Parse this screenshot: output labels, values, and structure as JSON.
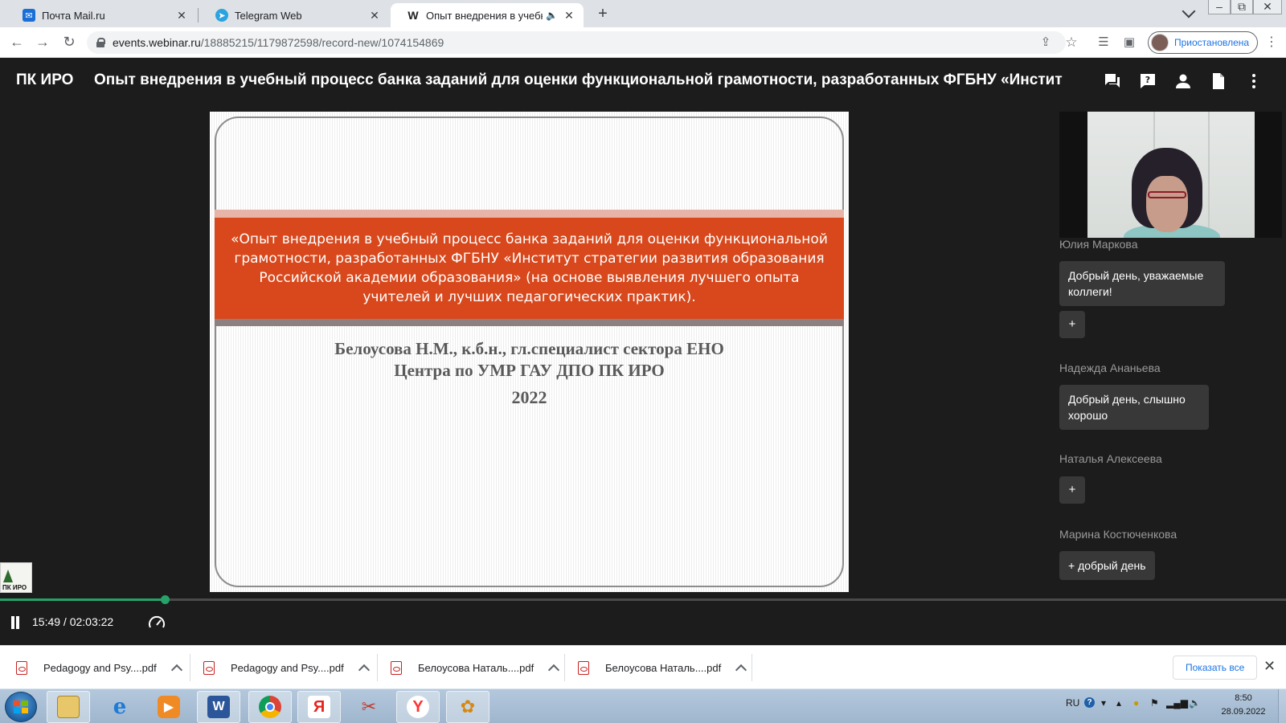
{
  "browser": {
    "tabs": [
      {
        "title": "Почта Mail.ru",
        "icon": "mail-icon",
        "active": false
      },
      {
        "title": "Telegram Web",
        "icon": "telegram-icon",
        "active": false
      },
      {
        "title": "Опыт внедрения в учебный",
        "icon": "webinar-w-icon",
        "active": true
      }
    ],
    "favicon_letter": "W",
    "tab_close": "✕",
    "new_tab": "+",
    "window_controls": {
      "minimize": "–",
      "restore": "⧉",
      "close": "✕"
    },
    "url_host": "events.webinar.ru",
    "url_path": "/18885215/1179872598/record-new/1074154869",
    "profile_label": "Приостановлена"
  },
  "webinar": {
    "org": "ПК ИРО",
    "title": "Опыт внедрения в учебный процесс банка заданий для оценки функциональной грамотности, разработанных ФГБНУ «Инстит",
    "slide": {
      "headline": "«Опыт внедрения в учебный процесс банка заданий для оценки функциональной грамотности, разработанных ФГБНУ «Институт стратегии развития образования Российской академии образования» (на основе выявления лучшего опыта учителей и лучших педагогических практик).",
      "author_line1": "Белоусова Н.М., к.б.н.,  гл.специалист сектора ЕНО",
      "author_line2": "Центра по УМР ГАУ ДПО ПК ИРО",
      "year": "2022"
    },
    "logo_text": "ПК ИРО",
    "chat": [
      {
        "name": "Юлия Маркова",
        "message": "Добрый день, уважаемые коллеги!",
        "plus": "+"
      },
      {
        "name": "Надежда Ананьева",
        "message": "Добрый день, слышно хорошо"
      },
      {
        "name": "Наталья Алексеева",
        "plus": "+"
      },
      {
        "name": "Марина Костюченкова",
        "message": "+ добрый день"
      }
    ],
    "player": {
      "timecode": "15:49 / 02:03:22",
      "progress_fraction": 0.128
    }
  },
  "downloads": {
    "items": [
      {
        "name": "Pedagogy and Psy....pdf"
      },
      {
        "name": "Pedagogy and Psy....pdf"
      },
      {
        "name": "Белоусова Наталь....pdf"
      },
      {
        "name": "Белоусова Наталь....pdf"
      }
    ],
    "show_all": "Показать все",
    "close": "✕"
  },
  "taskbar": {
    "apps": [
      "explorer-icon",
      "ie-icon",
      "media-player-icon",
      "word-icon",
      "chrome-icon",
      "yandex-icon",
      "scissors-icon",
      "yandex-browser-icon",
      "paint-icon"
    ],
    "lang": "RU",
    "time": "8:50",
    "date": "28.09.2022"
  },
  "colors": {
    "accent_green": "#26a269",
    "slide_orange": "#d8481c",
    "chrome_blue": "#1a73e8"
  }
}
